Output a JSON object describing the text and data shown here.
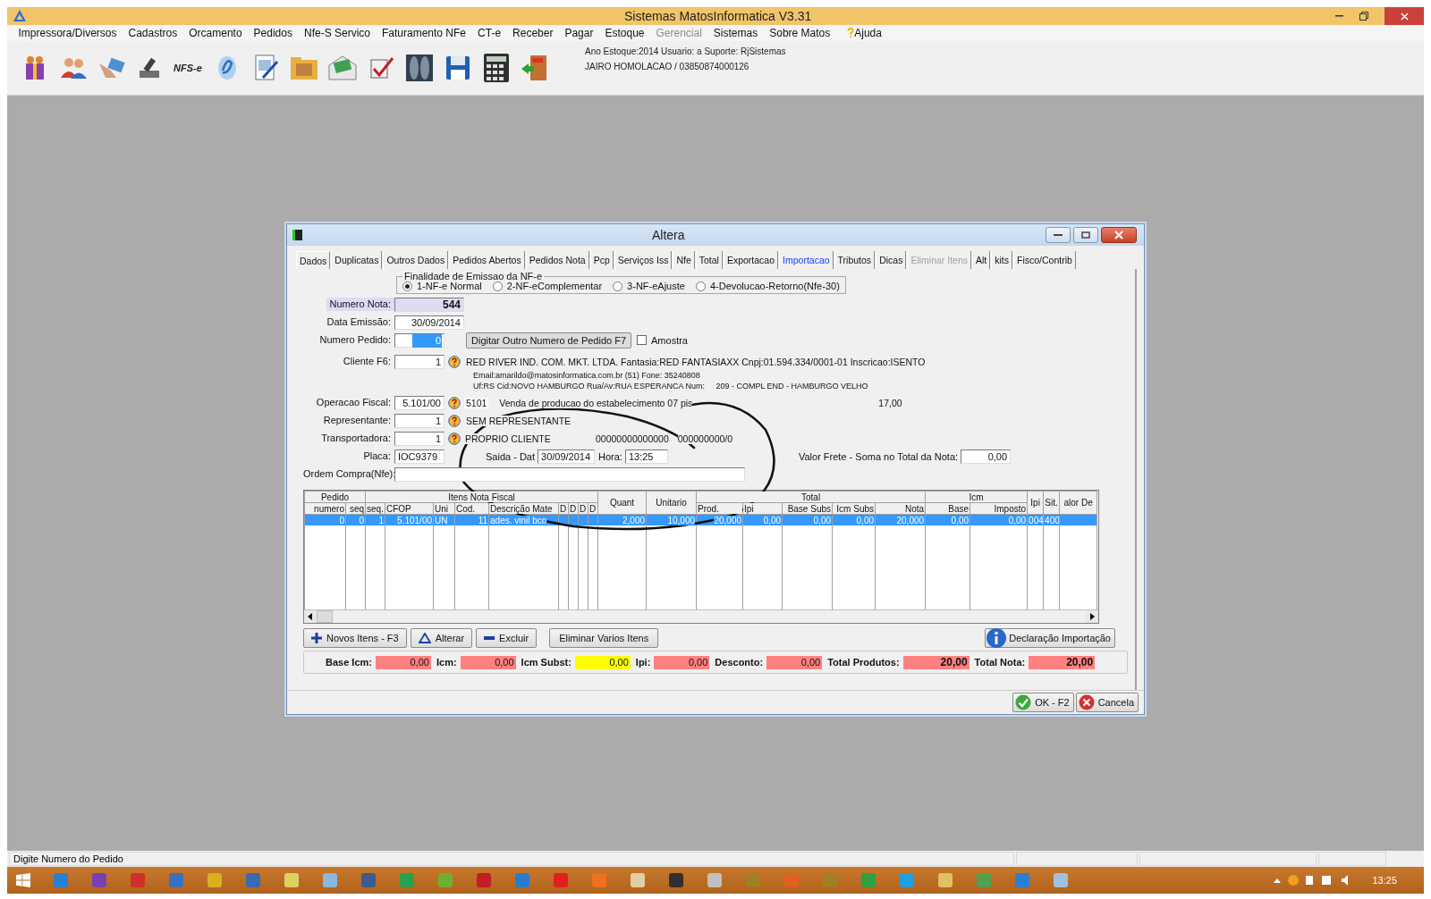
{
  "app": {
    "title": "Sistemas MatosInformatica V3.31"
  },
  "menu": [
    {
      "label": "Impressora/Diversos",
      "disabled": false,
      "kind": "plain"
    },
    {
      "label": "Cadastros",
      "disabled": false,
      "kind": "plain"
    },
    {
      "label": "Orcamento",
      "disabled": false,
      "kind": "plain"
    },
    {
      "label": "Pedidos",
      "disabled": false,
      "kind": "plain"
    },
    {
      "label": "Nfe-S Servico",
      "disabled": false,
      "kind": "plain"
    },
    {
      "label": "Faturamento NFe",
      "disabled": false,
      "kind": "plain"
    },
    {
      "label": "CT-e",
      "disabled": false,
      "kind": "plain"
    },
    {
      "label": "Receber",
      "disabled": false,
      "kind": "plain"
    },
    {
      "label": "Pagar",
      "disabled": false,
      "kind": "plain"
    },
    {
      "label": "Estoque",
      "disabled": false,
      "kind": "plain"
    },
    {
      "label": "Gerencial",
      "disabled": true,
      "kind": "plain"
    },
    {
      "label": "Sistemas",
      "disabled": false,
      "kind": "plain"
    },
    {
      "label": "Sobre Matos",
      "disabled": false,
      "kind": "plain"
    },
    {
      "label": "Ajuda",
      "disabled": false,
      "kind": "help"
    }
  ],
  "toolbar": {
    "nfs_label": "NFS-e",
    "info": [
      "Ano Estoque:2014 Usuario: a Suporte: RjSistemas",
      "JAIRO HOMOLACAO / 03850874000126"
    ]
  },
  "dialog": {
    "title": "Altera",
    "tabs": [
      {
        "label": "Dados",
        "selected": true,
        "disabled": false,
        "highlighted": false
      },
      {
        "label": "Duplicatas",
        "selected": false,
        "disabled": false,
        "highlighted": false
      },
      {
        "label": "Outros Dados",
        "selected": false,
        "disabled": false,
        "highlighted": false
      },
      {
        "label": "Pedidos Abertos",
        "selected": false,
        "disabled": false,
        "highlighted": false
      },
      {
        "label": "Pedidos Nota",
        "selected": false,
        "disabled": false,
        "highlighted": false
      },
      {
        "label": "Pcp",
        "selected": false,
        "disabled": false,
        "highlighted": false
      },
      {
        "label": "Serviços Iss",
        "selected": false,
        "disabled": false,
        "highlighted": false
      },
      {
        "label": "Nfe",
        "selected": false,
        "disabled": false,
        "highlighted": false
      },
      {
        "label": "Total",
        "selected": false,
        "disabled": false,
        "highlighted": false
      },
      {
        "label": "Exportacao",
        "selected": false,
        "disabled": false,
        "highlighted": false
      },
      {
        "label": "Importacao",
        "selected": false,
        "disabled": false,
        "highlighted": true
      },
      {
        "label": "Tributos",
        "selected": false,
        "disabled": false,
        "highlighted": false
      },
      {
        "label": "Dicas",
        "selected": false,
        "disabled": false,
        "highlighted": false
      },
      {
        "label": "Eliminar Itens",
        "selected": false,
        "disabled": true,
        "highlighted": false
      },
      {
        "label": "Alt",
        "selected": false,
        "disabled": false,
        "highlighted": false
      },
      {
        "label": "kits",
        "selected": false,
        "disabled": false,
        "highlighted": false
      },
      {
        "label": "Fisco/Contrib",
        "selected": false,
        "disabled": false,
        "highlighted": false
      }
    ],
    "finalidade": {
      "legend": "Finalidade de Emissao da NF-e",
      "options": [
        {
          "label": "1-NF-e Normal",
          "selected": true
        },
        {
          "label": "2-NF-eComplementar",
          "selected": false
        },
        {
          "label": "3-NF-eAjuste",
          "selected": false
        },
        {
          "label": "4-Devolucao-Retorno(Nfe-30)",
          "selected": false
        }
      ]
    },
    "numero_nota": {
      "label": "Numero Nota:",
      "value": "544"
    },
    "data_emissao": {
      "label": "Data Emissão:",
      "value": "30/09/2014"
    },
    "numero_pedido": {
      "label": "Numero Pedido:",
      "value": "0",
      "text_selected": true
    },
    "digitar_button": "Digitar Outro Numero de Pedido F7",
    "amostra": {
      "label": "Amostra",
      "checked": false
    },
    "cliente": {
      "label": "Cliente F6:",
      "value": "1",
      "lines": [
        "RED RIVER IND. COM. MKT. LTDA. Fantasia:RED FANTASIAXX Cnpj:01.594.334/0001-01 Inscricao:ISENTO",
        "Email:amarildo@matosinformatica.com.br (51) Fone: 35240808",
        "Uf:RS Cid:NOVO HAMBURGO Rua/Av:RUA ESPERANCA Num:     209 - COMPL END - HAMBURGO VELHO"
      ]
    },
    "operacao": {
      "label": "Operacao Fiscal:",
      "value": "5.101/00",
      "code": "5101",
      "description": "Venda de producao do estabelecimento 07 pis",
      "rate": "17,00"
    },
    "representante": {
      "label": "Representante:",
      "value": "1",
      "name": "SEM REPRESENTANTE"
    },
    "transportadora": {
      "label": "Transportadora:",
      "value": "1",
      "name": "PROPRIO CLIENTE",
      "cnpj": "00000000000000",
      "ie": "000000000/0"
    },
    "placa": {
      "label": "Placa:",
      "value": "IOC9379"
    },
    "saida": {
      "label": "Saida - Dat",
      "value": "30/09/2014"
    },
    "hora": {
      "label": "Hora:",
      "value": "13:25"
    },
    "valor_frete": {
      "label": "Valor Frete - Soma no Total da Nota:",
      "value": "0,00"
    },
    "ordem_compra": {
      "label": "Ordem Compra(Nfe):"
    },
    "table": {
      "groups": [
        {
          "label": "Pedido",
          "columns": [
            "numero",
            "seq"
          ]
        },
        {
          "label": "Itens Nota Fiscal",
          "columns": [
            "seq.",
            "CFOP",
            "Uni",
            "Cod.",
            "Descrição Mate",
            "D",
            "D",
            "D",
            "D"
          ]
        },
        {
          "label": "Quant"
        },
        {
          "label": "Unitario"
        },
        {
          "label": "Total",
          "columns": [
            "Prod.",
            "Ipi",
            "Base Subs",
            "Icm Subs",
            "Nota"
          ]
        },
        {
          "label": "Icm",
          "columns": [
            "Base",
            "Imposto"
          ]
        },
        {
          "label": "Ipi"
        },
        {
          "label": "Sit."
        },
        {
          "label": "alor De"
        }
      ],
      "rows": [
        {
          "selected": true,
          "cells": [
            "0",
            "0",
            "1",
            "5.101/00",
            "UN",
            "11",
            "ades. vinil bco",
            "",
            "",
            "",
            "",
            "2,000",
            "10,000",
            "20,000",
            "0,00",
            "0,00",
            "0,00",
            "20,000",
            "0,00",
            "0,00",
            "004",
            "400",
            ""
          ]
        }
      ]
    },
    "item_buttons": [
      {
        "label": "Novos Itens - F3",
        "kind": "add"
      },
      {
        "label": "Alterar",
        "kind": "edit"
      },
      {
        "label": "Excluir",
        "kind": "delete"
      },
      {
        "label": "Eliminar Varios Itens",
        "kind": "plain"
      }
    ],
    "import_button": "Declaração Importação",
    "totals": [
      {
        "label": "Base Icm:",
        "value": "0,00",
        "color": "#ff8080"
      },
      {
        "label": "Icm:",
        "value": "0,00",
        "color": "#ff8080"
      },
      {
        "label": "Icm Subst:",
        "value": "0,00",
        "color": "#ffff00"
      },
      {
        "label": "Ipi:",
        "value": "0,00",
        "color": "#ff8080"
      },
      {
        "label": "Desconto:",
        "value": "0,00",
        "color": "#ff8080"
      },
      {
        "label": "Total Produtos:",
        "value": "20,00",
        "color": "#ff8080"
      },
      {
        "label": "Total Nota:",
        "value": "20,00",
        "color": "#ff8080"
      }
    ],
    "footer_buttons": [
      {
        "label": "OK - F2",
        "kind": "ok"
      },
      {
        "label": "Cancela",
        "kind": "cancel"
      }
    ]
  },
  "status_bar": {
    "message": "Digite Numero do Pedido"
  },
  "taskbar": {
    "time": "13:25"
  }
}
